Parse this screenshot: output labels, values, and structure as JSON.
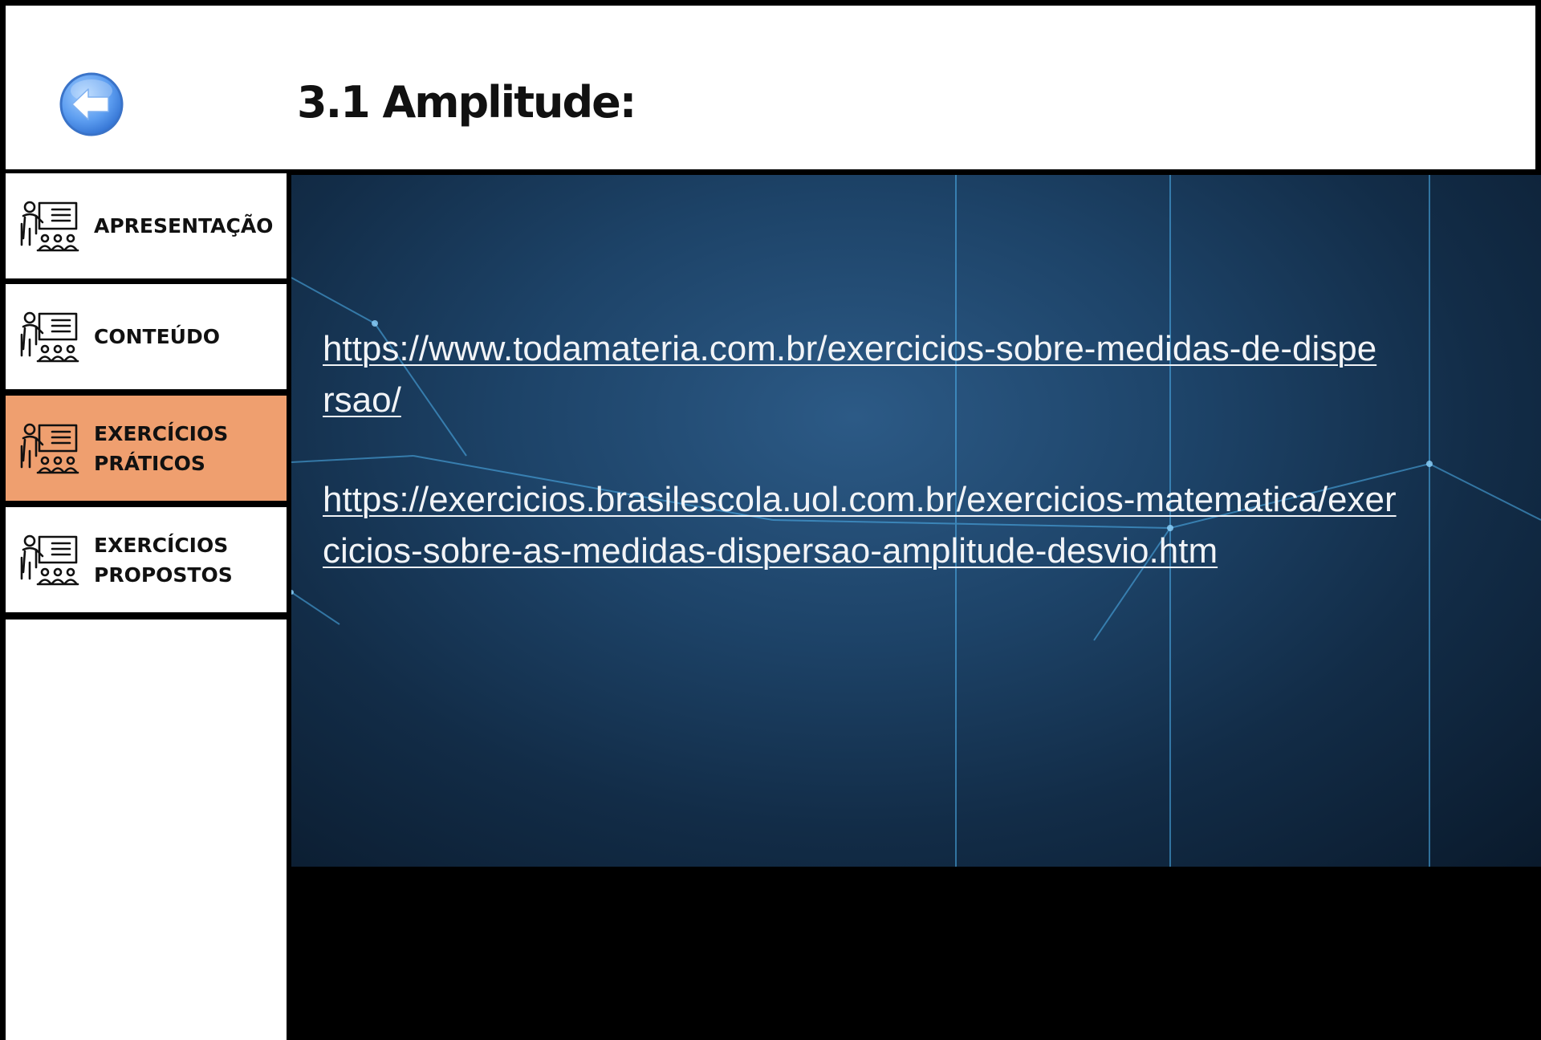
{
  "header": {
    "title": "3.1 Amplitude:",
    "back_icon": "back-arrow-icon"
  },
  "sidebar": {
    "items": [
      {
        "label": "APRESENTAÇÃO",
        "icon": "teacher-presentation-icon",
        "active": false
      },
      {
        "label": "CONTEÚDO",
        "icon": "teacher-presentation-icon",
        "active": false
      },
      {
        "label": "EXERCÍCIOS\nPRÁTICOS",
        "icon": "teacher-presentation-icon",
        "active": true
      },
      {
        "label": "EXERCÍCIOS\nPROPOSTOS",
        "icon": "teacher-presentation-icon",
        "active": false
      }
    ]
  },
  "main": {
    "links": [
      "https://www.todamateria.com.br/exercicios-sobre-medidas-de-dispersao/",
      "https://exercicios.brasilescola.uol.com.br/exercicios-matematica/exercicios-sobre-as-medidas-dispersao-amplitude-desvio.htm"
    ]
  },
  "colors": {
    "active_nav": "#ef9f6f",
    "header_bg": "#ffffff",
    "content_bg": "#1d4368",
    "link_text": "#f2f4f7"
  }
}
